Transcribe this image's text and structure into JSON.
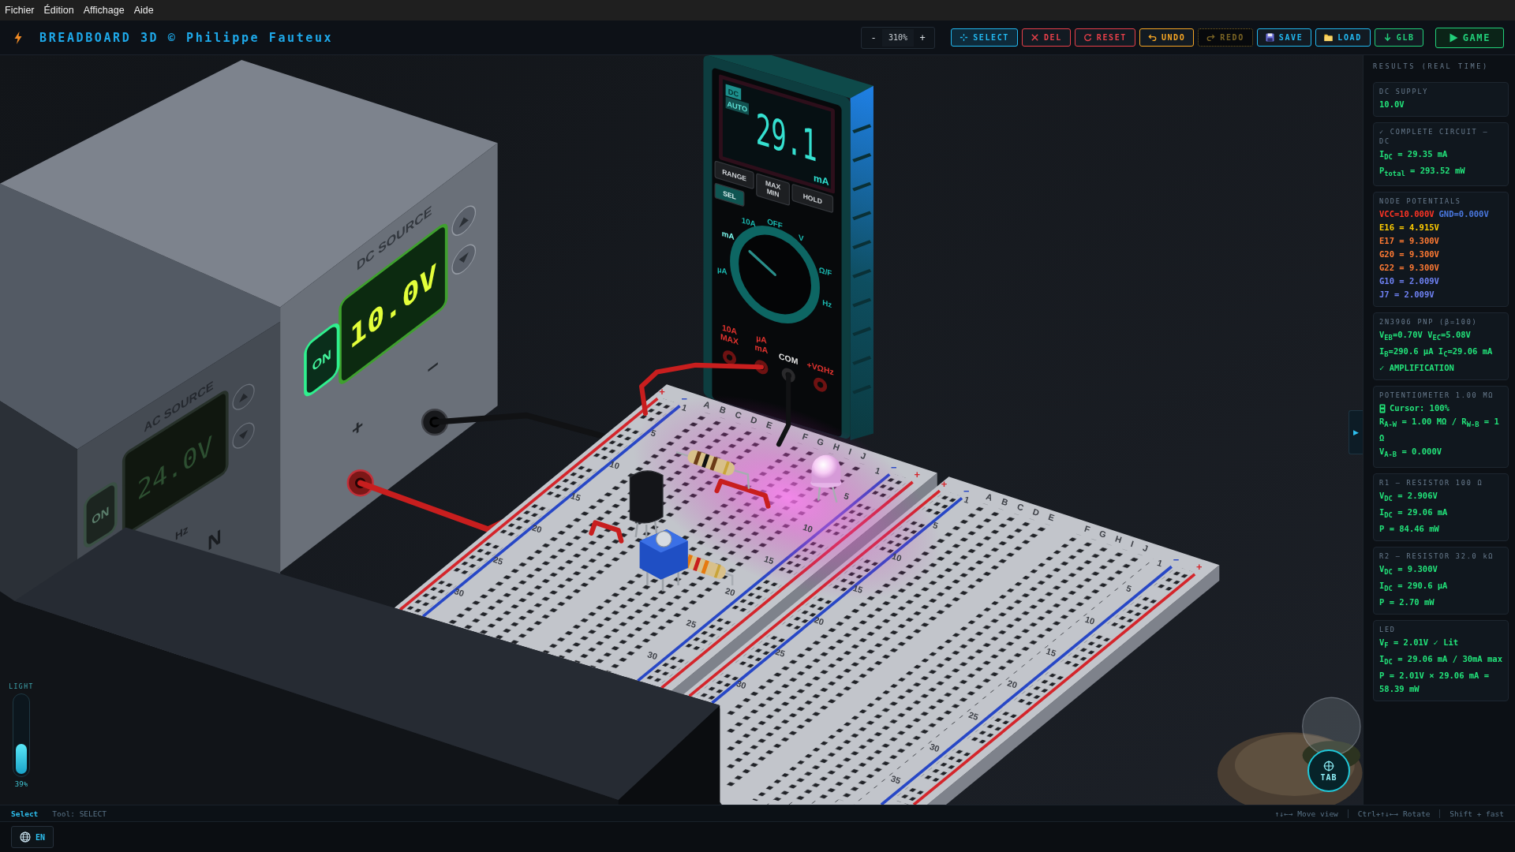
{
  "menu": [
    "Fichier",
    "Édition",
    "Affichage",
    "Aide"
  ],
  "header": {
    "title": "BREADBOARD 3D © Philippe Fauteux",
    "zoom": {
      "minus": "-",
      "value": "310%",
      "plus": "+"
    },
    "tools": [
      {
        "label": "SELECT",
        "kind": "select",
        "color": "#22b8f0",
        "selected": true,
        "disabled": false
      },
      {
        "label": "DEL",
        "kind": "delete",
        "color": "#e8404a",
        "selected": false,
        "disabled": false
      },
      {
        "label": "RESET",
        "kind": "reset",
        "color": "#e8404a",
        "selected": false,
        "disabled": false
      },
      {
        "label": "UNDO",
        "kind": "undo",
        "color": "#f5a524",
        "selected": false,
        "disabled": false
      },
      {
        "label": "REDO",
        "kind": "redo",
        "color": "#7a6424",
        "selected": false,
        "disabled": true
      },
      {
        "label": "SAVE",
        "kind": "save",
        "color": "#22b8f0",
        "selected": false,
        "disabled": false
      },
      {
        "label": "LOAD",
        "kind": "load",
        "color": "#22b8f0",
        "selected": false,
        "disabled": false
      },
      {
        "label": "GLB",
        "kind": "export",
        "color": "#22d07a",
        "selected": false,
        "disabled": false
      },
      {
        "label": "GAME",
        "kind": "play",
        "color": "#22d07a",
        "selected": false,
        "disabled": false
      }
    ]
  },
  "scene": {
    "ac_source": {
      "label": "AC SOURCE",
      "reading": "24.0V",
      "on_label": "ON",
      "on": false,
      "unit": "Hz",
      "neutral": "N"
    },
    "dc_source": {
      "label": "DC SOURCE",
      "reading": "10.0V",
      "on_label": "ON",
      "on": true,
      "plus": "+",
      "minus": "−"
    },
    "multimeter": {
      "badges": [
        "DC",
        "AUTO"
      ],
      "reading": "29.1",
      "unit": "mA",
      "buttons": [
        [
          "RANGE"
        ],
        [
          "MAX",
          "MIN"
        ],
        [
          "HOLD"
        ],
        [
          "SEL"
        ]
      ],
      "dial": [
        {
          "label": "mA",
          "selected": true
        },
        {
          "label": "10A",
          "selected": false
        },
        {
          "label": "OFF",
          "selected": false
        },
        {
          "label": "V",
          "selected": false
        },
        {
          "label": "Ω/F",
          "selected": false
        },
        {
          "label": "Hz",
          "selected": false
        },
        {
          "label": "µA",
          "selected": false
        }
      ],
      "jacks": [
        {
          "label": [
            "10A",
            "MAX"
          ],
          "kind": "input"
        },
        {
          "label": [
            "µA",
            "mA"
          ],
          "kind": "input"
        },
        {
          "label": [
            "COM"
          ],
          "kind": "common"
        },
        {
          "label": [
            "+VΩHz"
          ],
          "kind": "input"
        }
      ]
    },
    "breadboard": {
      "boards": [
        {
          "letters_a": "ABCDE",
          "letters_f": "FGHIJ",
          "rails": [
            {
              "sign": "+",
              "color": "#d4252b"
            },
            {
              "sign": "−",
              "color": "#2747c6"
            },
            {
              "sign": "−",
              "color": "#2747c6"
            },
            {
              "sign": "+",
              "color": "#d4252b"
            }
          ],
          "column_labels_ae": [
            "1",
            "5",
            "10",
            "15",
            "20",
            "25",
            "30"
          ],
          "column_labels_fj": [
            "1",
            "5",
            "10",
            "15",
            "20",
            "25",
            "30"
          ]
        },
        {
          "letters_a": "ABCDE",
          "letters_f": "FGHIJ",
          "rails": [
            {
              "sign": "+",
              "color": "#d4252b"
            },
            {
              "sign": "−",
              "color": "#2747c6"
            },
            {
              "sign": "−",
              "color": "#2747c6"
            },
            {
              "sign": "+",
              "color": "#d4252b"
            }
          ],
          "column_labels_ae": [
            "1",
            "5",
            "10",
            "15",
            "20",
            "25",
            "30"
          ],
          "column_labels_fj": [
            "1",
            "5",
            "10",
            "15",
            "20",
            "25",
            "30",
            "35"
          ]
        }
      ]
    },
    "light": {
      "label": "LIGHT",
      "level": 0.39,
      "reading": "39%"
    },
    "view_button": "TAB",
    "panel_toggle": "▶"
  },
  "results": {
    "title": "RESULTS (REAL TIME)",
    "cards": [
      {
        "title": "DC SUPPLY",
        "lines": [
          "10.0V"
        ]
      },
      {
        "title": "✓ COMPLETE CIRCUIT — DC",
        "lines": [
          "I$_{DC}$ = 29.35 mA",
          "P$_{total}$ = 293.52 mW"
        ]
      },
      {
        "title": "NODE POTENTIALS",
        "rows": [
          [
            {
              "text": "VCC=10.000V",
              "color": "#ff3424"
            },
            {
              "text": "GND=0.000V",
              "color": "#4a78e0"
            }
          ],
          [
            {
              "text": "E16 = 4.915V",
              "color": "#ffcc00"
            }
          ],
          [
            {
              "text": "E17 = 9.300V",
              "color": "#ff7a33"
            }
          ],
          [
            {
              "text": "G20 = 9.300V",
              "color": "#ff7a33"
            }
          ],
          [
            {
              "text": "G22 = 9.300V",
              "color": "#ff7a33"
            }
          ],
          [
            {
              "text": "G10 = 2.009V",
              "color": "#6f82f5"
            }
          ],
          [
            {
              "text": "J7 = 2.009V",
              "color": "#6f82f5"
            }
          ]
        ]
      },
      {
        "title": "2N3906 PNP (β=100)",
        "lines": [
          "V$_{EB}$=0.70V V$_{EC}$=5.08V",
          "I$_{B}$=290.6 µA I$_{C}$=29.06 mA",
          "✓ AMPLIFICATION"
        ]
      },
      {
        "title": "POTENTIOMETER 1.00 MΩ",
        "cursor": "Cursor: 100%",
        "lines": [
          "R$_{A-W}$ = 1.00 MΩ / R$_{W-B}$ = 1 Ω",
          "V$_{A-B}$ = 0.000V"
        ]
      },
      {
        "title": "R1 — RESISTOR 100 Ω",
        "lines": [
          "V$_{DC}$ = 2.906V",
          "I$_{DC}$ = 29.06 mA",
          "P = 84.46 mW"
        ]
      },
      {
        "title": "R2 — RESISTOR 32.0 kΩ",
        "lines": [
          "V$_{DC}$ = 9.300V",
          "I$_{DC}$ = 290.6 µA",
          "P = 2.70 mW"
        ]
      },
      {
        "title": "LED",
        "lines": [
          "V$_{F}$ = 2.01V ✓ Lit",
          "I$_{DC}$ = 29.06 mA / 30mA max",
          "P = 2.01V × 29.06 mA = 58.39 mW"
        ]
      }
    ]
  },
  "status": {
    "mode": "Select",
    "tool": "Tool: SELECT",
    "hints": [
      "↑↓←→ Move view",
      "Ctrl+↑↓←→ Rotate",
      "Shift + fast"
    ]
  },
  "footer": {
    "language": "EN"
  }
}
